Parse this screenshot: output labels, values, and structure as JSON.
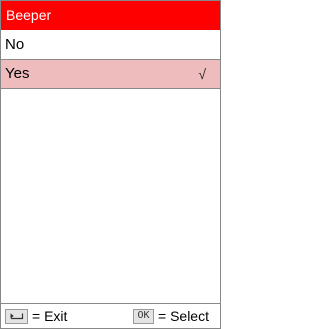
{
  "header": {
    "title": "Beeper"
  },
  "options": [
    {
      "label": "No",
      "selected": false
    },
    {
      "label": "Yes",
      "selected": true,
      "check_mark": "√"
    }
  ],
  "footer": {
    "exit_key": "back-arrow-icon",
    "exit_label": "= Exit",
    "select_key_label": "OK",
    "select_label": "= Select"
  },
  "colors": {
    "title_bar": "#fe0000",
    "selected_row": "#eebcbc"
  }
}
